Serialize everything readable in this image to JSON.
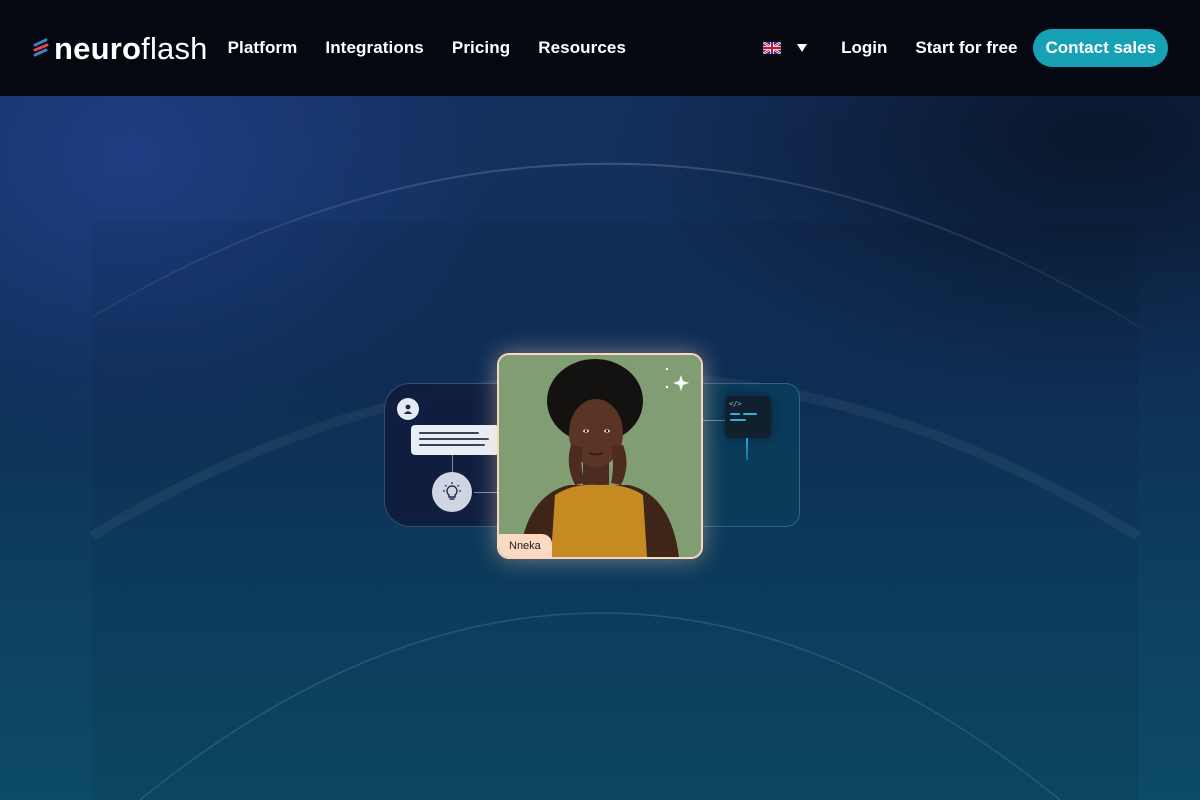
{
  "brand": {
    "name_bold": "neuro",
    "name_light": "flash"
  },
  "nav": {
    "items": [
      {
        "label": "Platform"
      },
      {
        "label": "Integrations"
      },
      {
        "label": "Pricing"
      },
      {
        "label": "Resources"
      }
    ],
    "language": {
      "icon": "uk-flag-icon",
      "caret": "chevron-down-icon"
    },
    "login_label": "Login",
    "start_label": "Start for free",
    "contact_label": "Contact sales"
  },
  "colors": {
    "nav_bg": "#050810",
    "accent": "#16a1b4",
    "name_tag_bg": "#fcd9c0",
    "portrait_border": "#f7d8be"
  },
  "illustration": {
    "persona_name": "Nneka",
    "icons": [
      "user-icon",
      "chat-bubble-icon",
      "lightbulb-icon",
      "code-icon",
      "sparkle-icon"
    ]
  }
}
